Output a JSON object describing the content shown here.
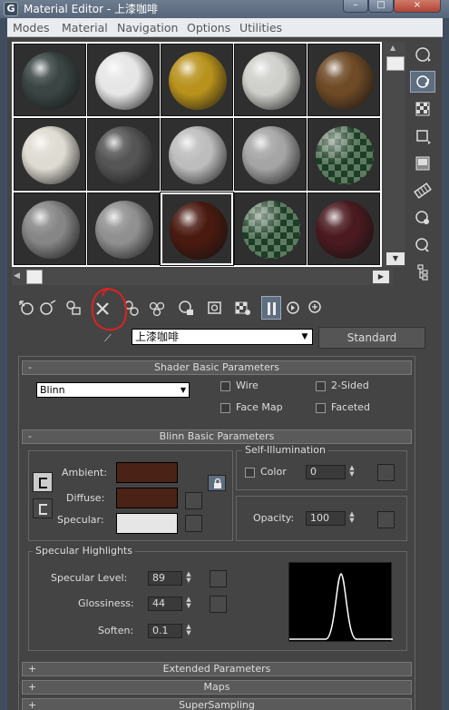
{
  "window": {
    "title": "Material Editor - 上漆咖啡",
    "app_icon_letter": "G",
    "controls": [
      "–",
      "□",
      "×"
    ]
  },
  "menu": [
    "Modes",
    "Material",
    "Navigation",
    "Options",
    "Utilities"
  ],
  "slots": [
    {
      "color": "#3a4544"
    },
    {
      "color": "#e6e6e6"
    },
    {
      "color": "#b8921c"
    },
    {
      "color": "#cfd0cb"
    },
    {
      "color": "#6e4a26"
    },
    {
      "color": "#dedbd2"
    },
    {
      "color": "#555555"
    },
    {
      "color": "#bdbdbd"
    },
    {
      "color": "#a5a5a5"
    },
    {
      "color": "#24402b",
      "checker": true
    },
    {
      "color": "#868686"
    },
    {
      "color": "#909090"
    },
    {
      "color": "#4a1a10",
      "selected": true
    },
    {
      "color": "#24402b",
      "checker": true
    },
    {
      "color": "#4a1a20"
    }
  ],
  "material": {
    "name": "上漆咖啡",
    "type": "Standard"
  },
  "shader_basic": {
    "header": "Shader Basic Parameters",
    "sign": "-",
    "shader": "Blinn",
    "options": [
      "Wire",
      "2-Sided",
      "Face Map",
      "Faceted"
    ]
  },
  "blinn_basic": {
    "header": "Blinn Basic Parameters",
    "sign": "-",
    "ambient_label": "Ambient:",
    "diffuse_label": "Diffuse:",
    "specular_label": "Specular:",
    "ambient_color": "#4a2216",
    "diffuse_color": "#4a2216",
    "specular_color": "#e6e6e6",
    "self_illum_title": "Self-Illumination",
    "color_label": "Color",
    "self_illum_value": "0",
    "opacity_label": "Opacity:",
    "opacity_value": "100",
    "spec_highlights_title": "Specular Highlights",
    "specular_level_label": "Specular Level:",
    "specular_level": "89",
    "glossiness_label": "Glossiness:",
    "glossiness": "44",
    "soften_label": "Soften:",
    "soften": "0.1"
  },
  "collapsed_rollouts": [
    {
      "sign": "+",
      "label": "Extended Parameters"
    },
    {
      "sign": "+",
      "label": "Maps"
    },
    {
      "sign": "+",
      "label": "SuperSampling"
    }
  ],
  "right_toolbar_icons": [
    "sample-type-icon",
    "backlight-icon",
    "background-icon",
    "uv-tiling-icon",
    "video-color-check-icon",
    "make-preview-icon",
    "options-icon",
    "select-by-material-icon",
    "material-navigator-icon"
  ],
  "bottom_toolbar_icons": [
    "get-material-icon",
    "put-to-scene-icon",
    "assign-to-selection-icon",
    "reset-map-icon",
    "make-unique-icon",
    "put-to-library-icon",
    "material-id-channel-icon",
    "show-map-in-viewport-icon",
    "show-end-result-icon",
    "go-to-parent-icon",
    "go-forward-icon",
    "pick-from-object-icon"
  ]
}
